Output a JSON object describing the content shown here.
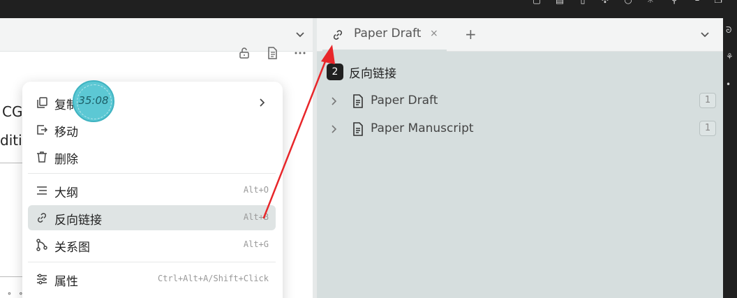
{
  "left_editor": {
    "text_line1": "CG",
    "text_line2": "ditic"
  },
  "right_tab": {
    "title": "Paper Draft",
    "close_glyph": "×",
    "new_tab_glyph": "+"
  },
  "backlinks": {
    "count": "2",
    "title": "反向链接",
    "items": [
      {
        "title": "Paper Draft",
        "count": "1"
      },
      {
        "title": "Paper Manuscript",
        "count": "1"
      }
    ]
  },
  "context_menu": {
    "items": [
      {
        "label": "复制",
        "shortcut": "",
        "icon": "copy-icon"
      },
      {
        "label": "移动",
        "shortcut": "",
        "icon": "move-icon"
      },
      {
        "label": "删除",
        "shortcut": "",
        "icon": "trash-icon"
      },
      {
        "label": "大纲",
        "shortcut": "Alt+O",
        "icon": "outline-icon"
      },
      {
        "label": "反向链接",
        "shortcut": "Alt+B",
        "icon": "link-icon"
      },
      {
        "label": "关系图",
        "shortcut": "Alt+G",
        "icon": "graph-icon"
      },
      {
        "label": "属性",
        "shortcut": "Ctrl+Alt+A/Shift+Click",
        "icon": "properties-icon"
      }
    ]
  },
  "timer": {
    "value": "35:08"
  },
  "colors": {
    "pane_bg": "#d6dede",
    "badge_bg": "#202020",
    "menu_active": "#dfe4e4",
    "annotation": "#e8262a",
    "timer": "#5cc8d4"
  }
}
